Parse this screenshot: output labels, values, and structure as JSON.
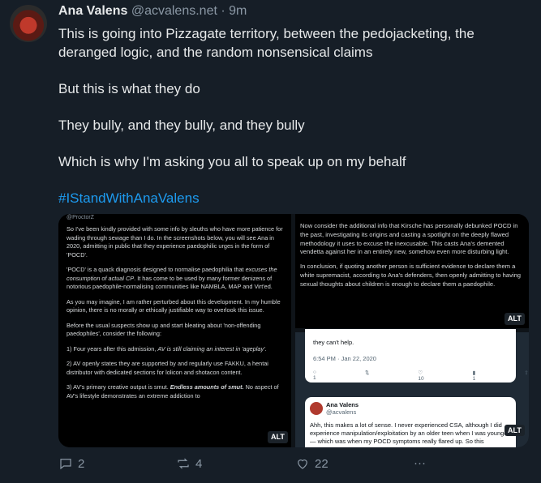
{
  "post": {
    "author_name": "Ana Valens",
    "author_handle": "@acvalens.net",
    "separator": "·",
    "time": "9m",
    "paragraphs": [
      "This is going into Pizzagate territory, between the pedojacketing, the deranged logic, and the random nonsensical claims",
      "But this is what they do",
      "They bully, and they bully, and they bully",
      "Which is why I'm asking you all to speak up on my behalf"
    ],
    "hashtag": "#IStandWithAnaValens"
  },
  "media": {
    "image1": {
      "top_handle": "@ProctorZ",
      "p1": "So I've been kindly provided with some info by sleuths who have more patience for wading through sewage than I do. In the screenshots below, you will see Ana in 2020, admitting in public that they experience paedophilic urges in the form of 'POCD'.",
      "p2a": "'POCD' is a quack diagnosis designed to normalise paedophilia that ",
      "p2b": "excuses the consumption of actual CP",
      "p2c": ". It has come to be used by many former denizens of notorious paedophile-normalising communities like NAMBLA, MAP and Virt'ed.",
      "p3": "As you may imagine, I am rather perturbed about this development. In my humble opinion, there is no morally or ethically justifiable way to overlook this issue.",
      "p4": "Before the usual suspects show up and start bleating about 'non-offending paedophiles', consider the following:",
      "l1a": "1) Four years after this admission, ",
      "l1b": "AV is still claiming an interest in 'ageplay'",
      "l1c": ".",
      "l2": "2) AV openly states they are supported by and regularly use FAKKU, a hentai distributor with dedicated sections for lolicon and shotacon content.",
      "l3a": "3) AV's primary creative output is smut. ",
      "l3b": "Endless amounts of smut.",
      "l3c": " No aspect of AV's lifestyle demonstrates an extreme addiction to",
      "alt": "ALT"
    },
    "image2": {
      "p1": "Now consider the additional info that Kirsche has personally debunked POCD in the past, investigating its origins and casting a spotlight on the deeply flawed methodology it uses to excuse the inexcusable. This casts Ana's demented vendetta against her in an entirely new, somehow even more disturbing light.",
      "p2": "In conclusion, if quoting another person is sufficient evidence to declare them a white supremacist, according to Ana's defenders, then openly admitting to having sexual thoughts about children is enough to declare them a paedophile.",
      "alt": "ALT"
    },
    "image3": {
      "card1_text": "they can't help.",
      "card1_time": "6:54 PM · Jan 22, 2020",
      "card1_counts": [
        "1",
        "10",
        "1"
      ],
      "card2_name": "Ana Valens",
      "card2_handle": "@acvalens",
      "card2_text": "Ahh, this makes a lot of sense. I never experienced CSA, although I did experience manipulation/exploitation by an older teen when I was younger — which was when my POCD symptoms really flared up. So this",
      "alt": "ALT"
    }
  },
  "actions": {
    "replies": "2",
    "reposts": "4",
    "likes": "22",
    "more": "···"
  },
  "colors": {
    "background": "#161e27",
    "accent": "#1d9bf0",
    "muted": "#8b98a5"
  }
}
